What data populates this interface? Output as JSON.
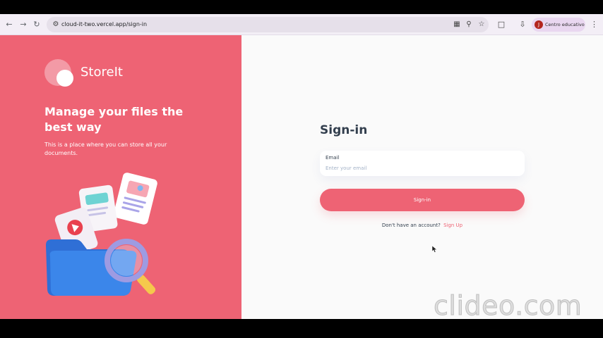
{
  "browser": {
    "url": "cloud-it-two.vercel.app/sign-in",
    "profile_initial": "J",
    "profile_name": "Centro educativo",
    "icons": [
      "back-icon",
      "forward-icon",
      "reload-icon",
      "site-info-icon",
      "translate-icon",
      "zoom-icon",
      "bookmark-star-icon",
      "extensions-icon",
      "download-icon",
      "menu-dots-icon"
    ]
  },
  "brand": {
    "name": "StoreIt"
  },
  "hero": {
    "headline": "Manage your files the best way",
    "subtext": "This is a place where you can store all your documents."
  },
  "form": {
    "title": "Sign-in",
    "email_label": "Email",
    "email_placeholder": "Enter your email",
    "email_value": "",
    "submit_label": "Sign-in",
    "signup_prompt": "Don't have an account?",
    "signup_link": "Sign Up"
  },
  "watermark": {
    "text": "clideo.com"
  },
  "colors": {
    "brand": "#ee6374",
    "heading": "#333f4e",
    "placeholder": "#a3b2c7"
  }
}
